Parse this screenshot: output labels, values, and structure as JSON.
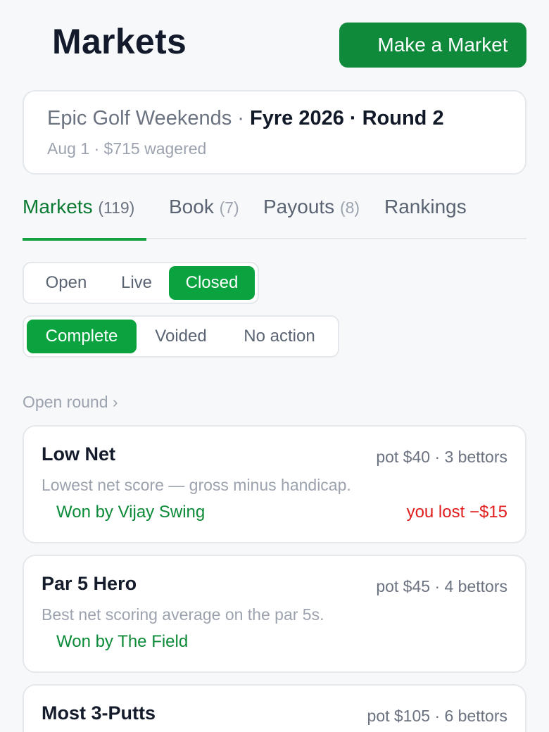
{
  "header": {
    "title": "Markets",
    "make_market_label": "Make a Market"
  },
  "event": {
    "league": "Epic Golf Weekends",
    "separator": " · ",
    "tournament_round": "Fyre 2026 · Round 2",
    "date_line": "Aug 1 · $715 wagered"
  },
  "tabs": [
    {
      "label": "Markets",
      "count": "(119)",
      "active": true
    },
    {
      "label": "Book",
      "count": "(7)",
      "active": false
    },
    {
      "label": "Payouts",
      "count": "(8)",
      "active": false
    },
    {
      "label": "Rankings",
      "count": "",
      "active": false
    }
  ],
  "status_filter": {
    "options": [
      "Open",
      "Live",
      "Closed"
    ],
    "selected": "Closed"
  },
  "result_filter": {
    "options": [
      "Complete",
      "Voided",
      "No action"
    ],
    "selected": "Complete"
  },
  "breadcrumb": {
    "label": "Open round",
    "chevron": "›"
  },
  "markets": [
    {
      "name": "Low Net",
      "meta": "pot $40 · 3 bettors",
      "description": "Lowest net score — gross minus handicap.",
      "winner": "Won by Vijay Swing",
      "result": "you lost −$15"
    },
    {
      "name": "Par 5 Hero",
      "meta": "pot $45 · 4 bettors",
      "description": "Best net scoring average on the par 5s.",
      "winner": "Won by The Field",
      "result": ""
    },
    {
      "name": "Most 3-Putts",
      "meta": "pot $105 · 6 bettors",
      "description": "",
      "winner": "",
      "result": ""
    }
  ],
  "colors": {
    "accent": "#0e8a3a",
    "active_segment": "#0aa33f",
    "loss": "#e11d1d",
    "win_text": "#0b8a37"
  }
}
